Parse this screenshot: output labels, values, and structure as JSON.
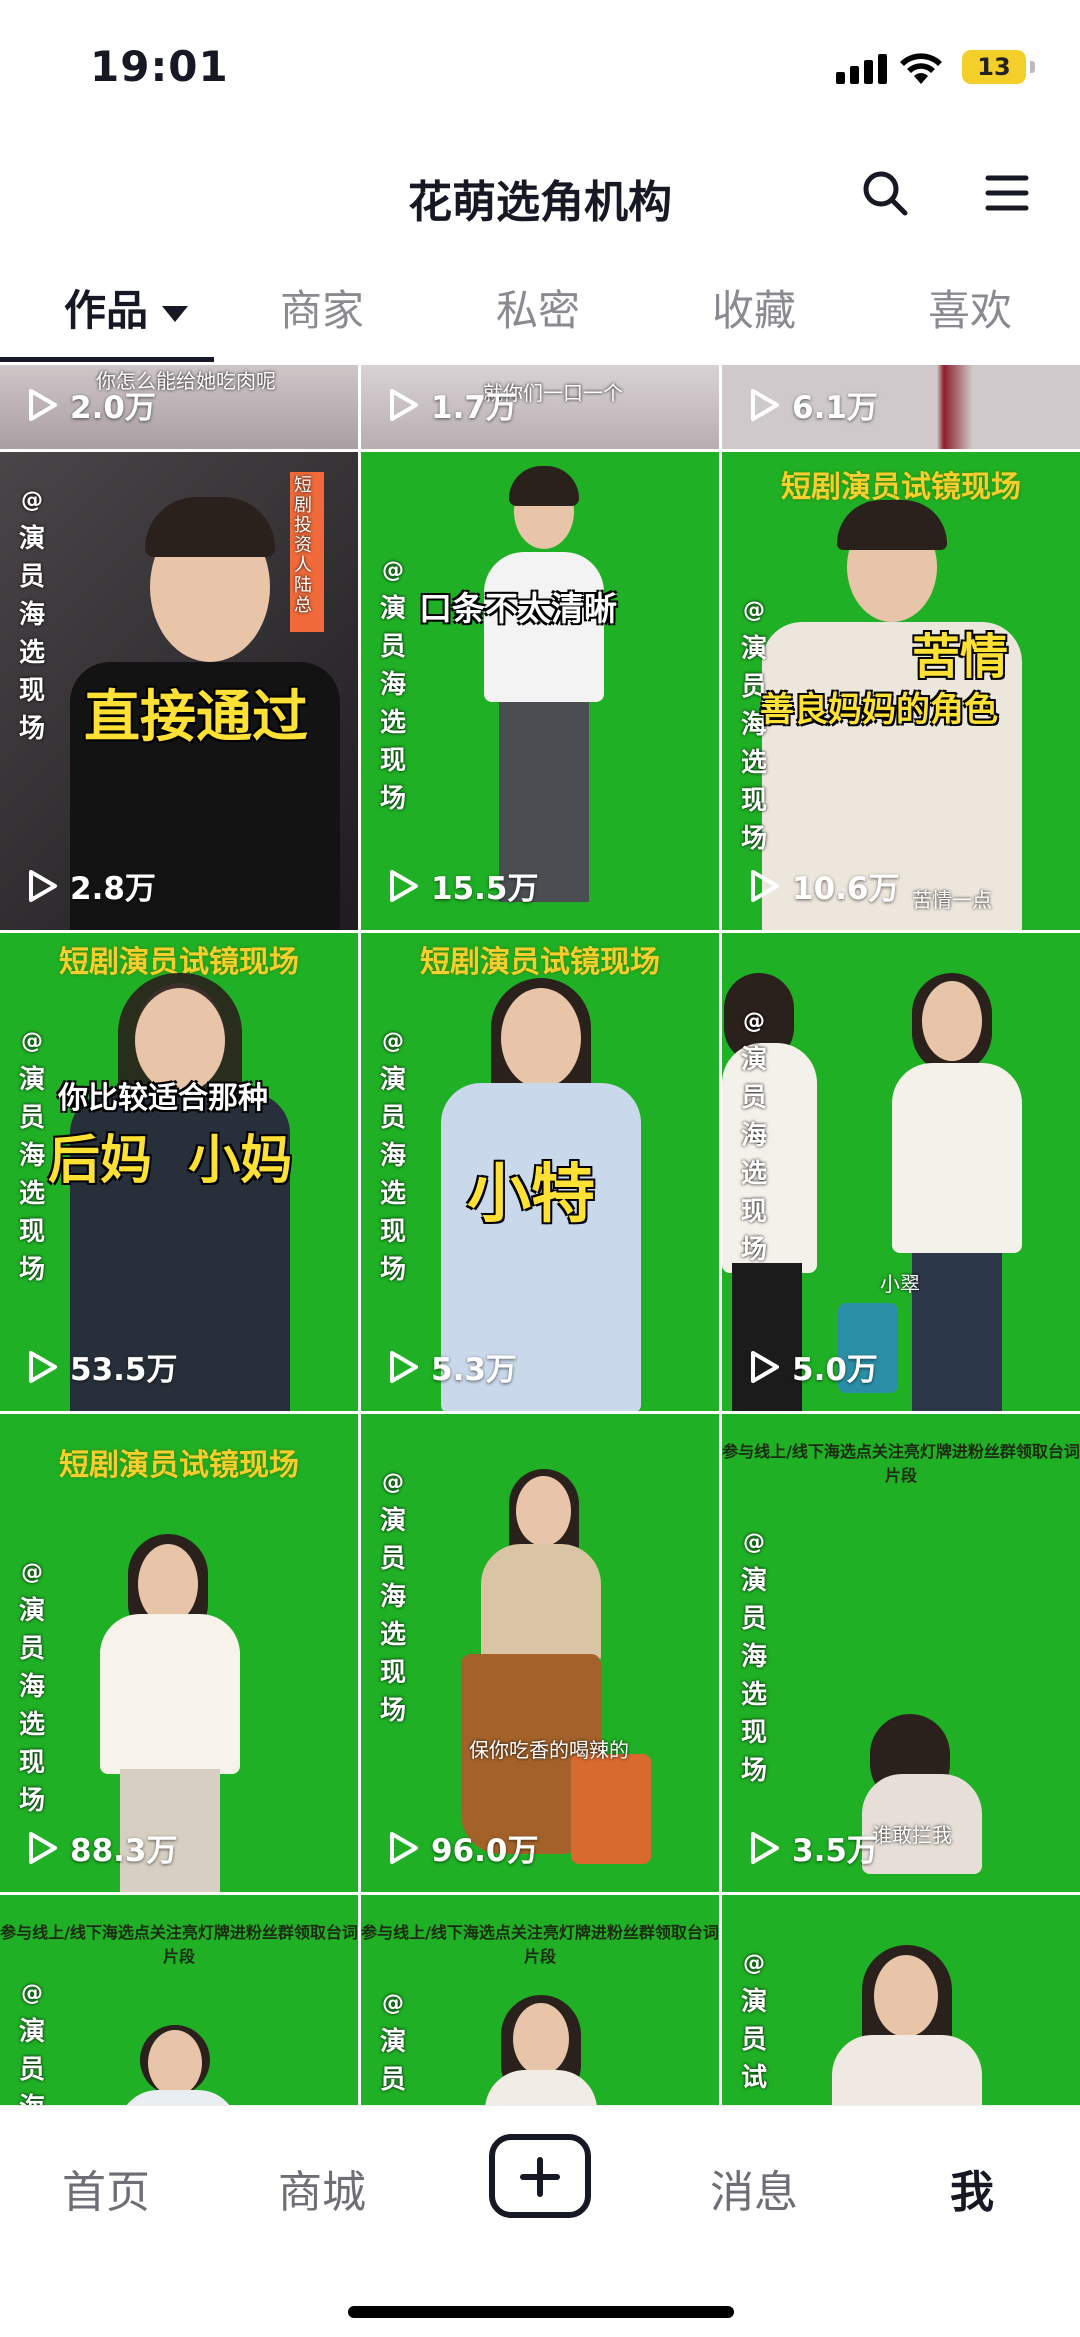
{
  "status_bar": {
    "time": "19:01",
    "battery": "13"
  },
  "header": {
    "title": "花萌选角机构"
  },
  "tabs": [
    {
      "label": "作品",
      "active": true
    },
    {
      "label": "商家"
    },
    {
      "label": "私密"
    },
    {
      "label": "收藏"
    },
    {
      "label": "喜欢"
    }
  ],
  "videos": [
    {
      "views": "2.0万",
      "caption": "你怎么能给她吃肉呢"
    },
    {
      "views": "1.7万",
      "caption": "就你们一口一个"
    },
    {
      "views": "6.1万"
    },
    {
      "views": "2.8万",
      "caption": "直接通过",
      "tag": "演员海选现场",
      "side_label": "短剧投资人 陆总"
    },
    {
      "views": "15.5万",
      "caption": "口条不太清晰",
      "tag": "演员海选现场"
    },
    {
      "views": "10.6万",
      "banner": "短剧演员试镜现场",
      "caption_a": "苦情",
      "caption_b": "善良妈妈的角色",
      "tag": "演员海选现场",
      "subtitle": "苦情一点"
    },
    {
      "views": "53.5万",
      "banner": "短剧演员试镜现场",
      "caption_a": "你比较适合那种",
      "caption_b": "后妈  小妈",
      "tag": "演员海选现场"
    },
    {
      "views": "5.3万",
      "banner": "短剧演员试镜现场",
      "caption": "小特",
      "tag": "演员海选现场"
    },
    {
      "views": "5.0万",
      "tag": "演员海选现场",
      "subtitle": "小翠"
    },
    {
      "views": "88.3万",
      "banner": "短剧演员试镜现场",
      "tag": "演员海选现场"
    },
    {
      "views": "96.0万",
      "tag": "演员海选现场",
      "subtitle": "保你吃香的喝辣的"
    },
    {
      "views": "3.5万",
      "tag": "演员海选现场",
      "subtitle": "谁敢拦我",
      "promo": "参与线上/线下海选点关注亮灯牌进粉丝群领取台词片段"
    },
    {
      "tag": "演员海",
      "promo": "参与线上/线下海选点关注亮灯牌进粉丝群领取台词片段"
    },
    {
      "tag": "演员",
      "promo": "参与线上/线下海选点关注亮灯牌进粉丝群领取台词片段"
    },
    {
      "tag": "演员试"
    }
  ],
  "bottom_nav": {
    "home": "首页",
    "mall": "商城",
    "messages": "消息",
    "me": "我"
  },
  "colors": {
    "green_screen": "#1fb025",
    "banner_yellow": "#f6cf2e",
    "caption_yellow": "#ffe135"
  }
}
